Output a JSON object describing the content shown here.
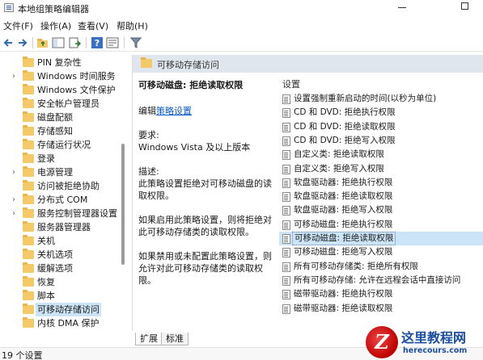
{
  "window": {
    "title": "本地组策略编辑器"
  },
  "menu": [
    "文件(F)",
    "操作(A)",
    "查看(V)",
    "帮助(H)"
  ],
  "toolbar": {
    "icons": [
      "back-arrow-icon",
      "forward-arrow-icon",
      "up-folder-icon",
      "show-hide-tree-icon",
      "export-list-icon",
      "help-icon",
      "properties-icon",
      "filter-icon"
    ]
  },
  "tree": {
    "items": [
      {
        "label": "PIN 复杂性",
        "expandable": false,
        "selected": false
      },
      {
        "label": "Windows 时间服务",
        "expandable": true,
        "selected": false
      },
      {
        "label": "Windows 文件保护",
        "expandable": false,
        "selected": false
      },
      {
        "label": "安全帐户管理员",
        "expandable": false,
        "selected": false
      },
      {
        "label": "磁盘配额",
        "expandable": false,
        "selected": false
      },
      {
        "label": "存储感知",
        "expandable": false,
        "selected": false
      },
      {
        "label": "存储运行状况",
        "expandable": false,
        "selected": false
      },
      {
        "label": "登录",
        "expandable": false,
        "selected": false
      },
      {
        "label": "电源管理",
        "expandable": true,
        "selected": false
      },
      {
        "label": "访问被拒绝协助",
        "expandable": false,
        "selected": false
      },
      {
        "label": "分布式 COM",
        "expandable": true,
        "selected": false
      },
      {
        "label": "服务控制管理器设置",
        "expandable": true,
        "selected": false
      },
      {
        "label": "服务器管理器",
        "expandable": false,
        "selected": false
      },
      {
        "label": "关机",
        "expandable": false,
        "selected": false
      },
      {
        "label": "关机选项",
        "expandable": false,
        "selected": false
      },
      {
        "label": "缓解选项",
        "expandable": false,
        "selected": false
      },
      {
        "label": "恢复",
        "expandable": false,
        "selected": false
      },
      {
        "label": "脚本",
        "expandable": false,
        "selected": false
      },
      {
        "label": "可移动存储访问",
        "expandable": false,
        "selected": true
      },
      {
        "label": "内核 DMA 保护",
        "expandable": false,
        "selected": false
      }
    ]
  },
  "right_header": {
    "label": "可移动存储访问"
  },
  "description": {
    "title": "可移动磁盘: 拒绝读取权限",
    "edit_prefix": "编辑",
    "edit_link": "策略设置",
    "requirements_label": "要求:",
    "requirements_value": "Windows Vista 及以上版本",
    "desc_label": "描述:",
    "desc_text": "此策略设置拒绝对可移动磁盘的读取权限。",
    "enabled_text": "如果启用此策略设置，则将拒绝对此可移动存储类的读取权限。",
    "disabled_text": "如果禁用或未配置此策略设置，则允许对此可移动存储类的读取权限。"
  },
  "settings": {
    "header": "设置",
    "items": [
      {
        "label": "设置强制重新启动的时间(以秒为单位)",
        "selected": false
      },
      {
        "label": "CD 和 DVD: 拒绝执行权限",
        "selected": false
      },
      {
        "label": "CD 和 DVD: 拒绝读取权限",
        "selected": false
      },
      {
        "label": "CD 和 DVD: 拒绝写入权限",
        "selected": false
      },
      {
        "label": "自定义类: 拒绝读取权限",
        "selected": false
      },
      {
        "label": "自定义类: 拒绝写入权限",
        "selected": false
      },
      {
        "label": "软盘驱动器: 拒绝执行权限",
        "selected": false
      },
      {
        "label": "软盘驱动器: 拒绝读取权限",
        "selected": false
      },
      {
        "label": "软盘驱动器: 拒绝写入权限",
        "selected": false
      },
      {
        "label": "可移动磁盘: 拒绝执行权限",
        "selected": false
      },
      {
        "label": "可移动磁盘: 拒绝读取权限",
        "selected": true
      },
      {
        "label": "可移动磁盘: 拒绝写入权限",
        "selected": false
      },
      {
        "label": "所有可移动存储类: 拒绝所有权限",
        "selected": false
      },
      {
        "label": "所有可移动存储: 允许在远程会话中直接访问",
        "selected": false
      },
      {
        "label": "磁带驱动器: 拒绝执行权限",
        "selected": false
      },
      {
        "label": "磁带驱动器: 拒绝读取权限",
        "selected": false
      }
    ]
  },
  "tabs": {
    "extended": "扩展",
    "standard": "标准"
  },
  "status": {
    "text": "19 个设置"
  },
  "watermark": {
    "logo_letter": "Z",
    "name": "这里教程网",
    "url": "herecours.com"
  }
}
